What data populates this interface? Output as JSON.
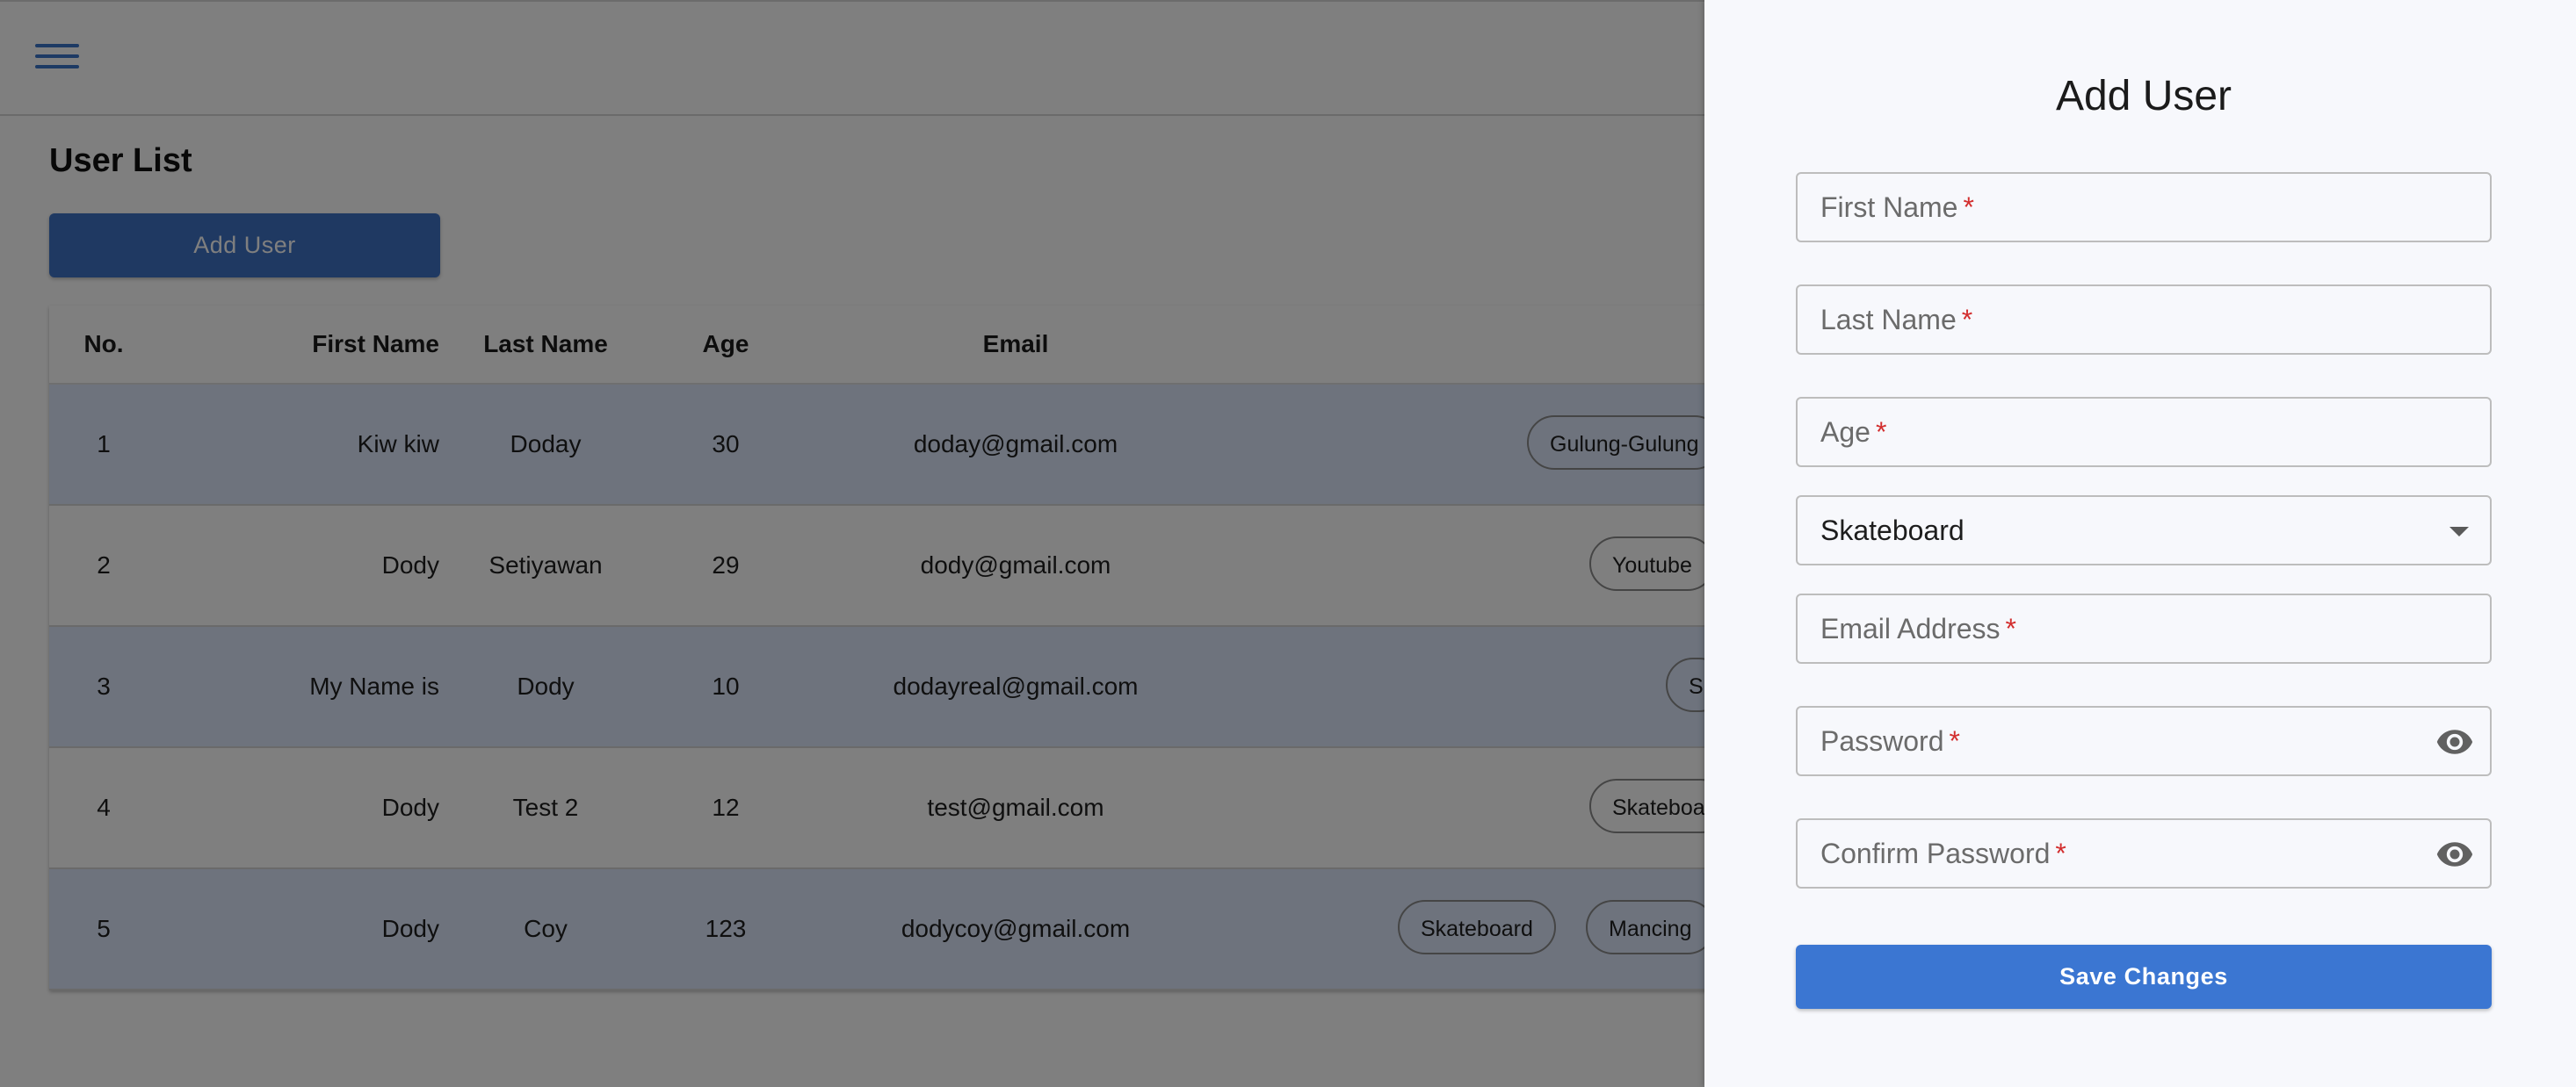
{
  "colors": {
    "accent": "#3b76d2",
    "required": "#d32f2f",
    "row_alt": "#dce7fb",
    "overlay": "rgba(0,0,0,0.5)"
  },
  "header": {
    "menu_icon": "hamburger-menu-icon"
  },
  "page": {
    "title": "User List",
    "add_user_label": "Add User"
  },
  "table": {
    "headers": {
      "no": "No.",
      "first_name": "First Name",
      "last_name": "Last Name",
      "age": "Age",
      "email": "Email"
    },
    "rows": [
      {
        "no": "1",
        "first_name": "Kiw kiw",
        "last_name": "Doday",
        "age": "30",
        "email": "doday@gmail.com",
        "hobbies": [
          "Gulung-Gulung"
        ]
      },
      {
        "no": "2",
        "first_name": "Dody",
        "last_name": "Setiyawan",
        "age": "29",
        "email": "dody@gmail.com",
        "hobbies": [
          "Youtube"
        ]
      },
      {
        "no": "3",
        "first_name": "My Name is",
        "last_name": "Dody",
        "age": "10",
        "email": "dodayreal@gmail.com",
        "hobbies": [
          "S"
        ]
      },
      {
        "no": "4",
        "first_name": "Dody",
        "last_name": "Test 2",
        "age": "12",
        "email": "test@gmail.com",
        "hobbies": [
          "Skateboa"
        ]
      },
      {
        "no": "5",
        "first_name": "Dody",
        "last_name": "Coy",
        "age": "123",
        "email": "dodycoy@gmail.com",
        "hobbies": [
          "Skateboard",
          "Mancing"
        ]
      }
    ]
  },
  "drawer": {
    "title": "Add User",
    "fields": {
      "first_name": {
        "label": "First Name",
        "required": "*",
        "value": ""
      },
      "last_name": {
        "label": "Last Name",
        "required": "*",
        "value": ""
      },
      "age": {
        "label": "Age",
        "required": "*",
        "value": ""
      },
      "hobby": {
        "value": "Skateboard"
      },
      "email": {
        "label": "Email Address",
        "required": "*",
        "value": ""
      },
      "password": {
        "label": "Password",
        "required": "*",
        "value": "",
        "icon": "eye-icon"
      },
      "confirm_password": {
        "label": "Confirm Password",
        "required": "*",
        "value": "",
        "icon": "eye-icon"
      }
    },
    "save_label": "Save Changes"
  }
}
